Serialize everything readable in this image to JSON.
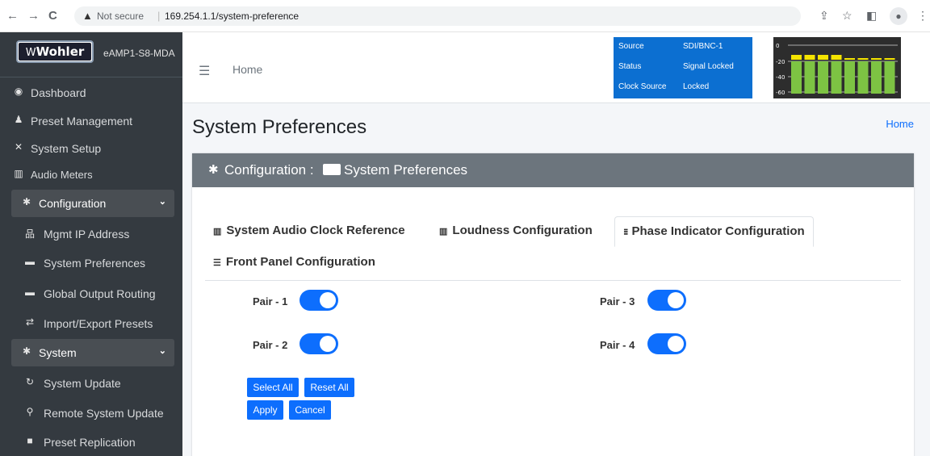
{
  "browser": {
    "back_icon": "←",
    "forward_icon": "→",
    "reload_icon": "C",
    "security_label": "Not secure",
    "url": "169.254.1.1/system-preference"
  },
  "sidebar": {
    "model": "eAMP1-S8-MDA",
    "logo_text": "Wohler",
    "items": [
      {
        "label": "Dashboard",
        "icon": "tachometer-icon",
        "glyph": "◉"
      },
      {
        "label": "Preset Management",
        "icon": "users-cog-icon",
        "glyph": "♟"
      },
      {
        "label": "System Setup",
        "icon": "tools-icon",
        "glyph": "✕"
      },
      {
        "label": "Audio Meters",
        "icon": "bar-chart-icon",
        "glyph": "▥"
      },
      {
        "label": "Configuration",
        "icon": "gear-icon",
        "glyph": "✱"
      },
      {
        "label": "Mgmt IP Address",
        "icon": "network-icon",
        "glyph": "品"
      },
      {
        "label": "System Preferences",
        "icon": "keyboard-icon",
        "glyph": "▬"
      },
      {
        "label": "Global Output Routing",
        "icon": "keyboard-icon",
        "glyph": "▬"
      },
      {
        "label": "Import/Export Presets",
        "icon": "exchange-icon",
        "glyph": "⇄"
      },
      {
        "label": "System",
        "icon": "gears-icon",
        "glyph": "✱"
      },
      {
        "label": "System Update",
        "icon": "sync-icon",
        "glyph": "↻"
      },
      {
        "label": "Remote System Update",
        "icon": "satellite-icon",
        "glyph": "⚲"
      },
      {
        "label": "Preset Replication",
        "icon": "clone-icon",
        "glyph": "■"
      }
    ]
  },
  "header": {
    "home_link": "Home",
    "status": {
      "source_key": "Source",
      "source_val": "SDI/BNC-1",
      "status_key": "Status",
      "status_val": "Signal Locked",
      "clock_key": "Clock Source",
      "clock_val": "Locked"
    },
    "meter_scale": [
      "0",
      "-20",
      "-40",
      "-60"
    ],
    "meter_colors": {
      "green": "#7dc343",
      "yellow": "#f5e400",
      "background": "#2d2d2d"
    }
  },
  "page": {
    "title": "System Preferences",
    "breadcrumb": "Home",
    "card_title": "Configuration : ",
    "card_subtitle": "System Preferences"
  },
  "tabs": [
    {
      "label": "System Audio Clock Reference",
      "icon": "chart-icon",
      "glyph": "▥"
    },
    {
      "label": "Loudness Configuration",
      "icon": "chart-icon",
      "glyph": "▥"
    },
    {
      "label": "Phase Indicator Configuration",
      "icon": "grid-icon",
      "glyph": "⁝⁝⁝"
    },
    {
      "label": "Front Panel Configuration",
      "icon": "list-icon",
      "glyph": "☰"
    }
  ],
  "pairs": [
    {
      "label": "Pair - 1",
      "on": true
    },
    {
      "label": "Pair - 2",
      "on": true
    },
    {
      "label": "Pair - 3",
      "on": true
    },
    {
      "label": "Pair - 4",
      "on": true
    }
  ],
  "buttons": {
    "select_all": "Select All",
    "reset_all": "Reset All",
    "apply": "Apply",
    "cancel": "Cancel"
  },
  "colors": {
    "accent": "#0d6efd",
    "sidebar": "#343a40",
    "status_panel": "#0c6fd1",
    "card_header": "#6c757d"
  }
}
